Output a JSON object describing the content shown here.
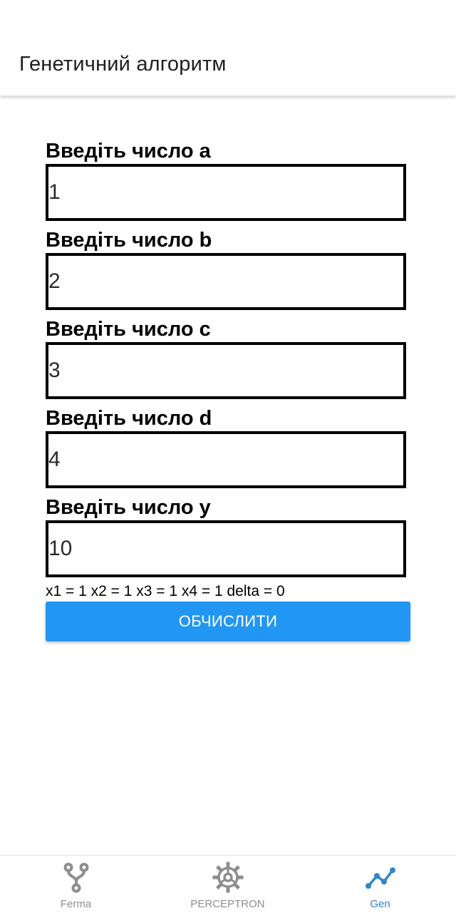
{
  "header": {
    "title": "Генетичний алгоритм"
  },
  "fields": [
    {
      "label": "Введіть число a",
      "value": "1"
    },
    {
      "label": "Введіть число b",
      "value": "2"
    },
    {
      "label": "Введіть число c",
      "value": "3"
    },
    {
      "label": "Введіть число d",
      "value": "4"
    },
    {
      "label": "Введіть число y",
      "value": "10"
    }
  ],
  "result": "x1 = 1 x2 = 1 x3 = 1 x4 = 1 delta = 0",
  "button": {
    "label": "ОБЧИСЛИТИ",
    "color": "#2196f3"
  },
  "tabs": [
    {
      "label": "Ferma",
      "icon": "fork-icon",
      "active": false
    },
    {
      "label": "PERCEPTRON",
      "icon": "gear-icon",
      "active": false
    },
    {
      "label": "Gen",
      "icon": "line-chart-icon",
      "active": true
    }
  ],
  "colors": {
    "active_tab": "#2f86c8",
    "inactive_tab": "#8e8e8e"
  }
}
